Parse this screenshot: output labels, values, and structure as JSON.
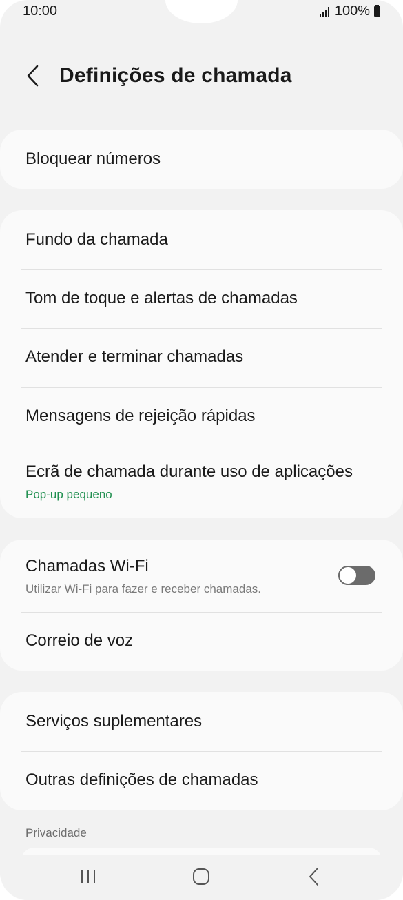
{
  "status_bar": {
    "time": "10:00",
    "battery": "100%",
    "icons": [
      "signal-icon",
      "battery-icon"
    ]
  },
  "header": {
    "title": "Definições de chamada",
    "back_icon": "chevron-left-icon"
  },
  "groups": [
    {
      "items": [
        {
          "title": "Bloquear números"
        }
      ]
    },
    {
      "items": [
        {
          "title": "Fundo da chamada"
        },
        {
          "title": "Tom de toque e alertas de chamadas"
        },
        {
          "title": "Atender e terminar chamadas"
        },
        {
          "title": "Mensagens de rejeição rápidas"
        },
        {
          "title": "Ecrã de chamada durante uso de aplicações",
          "subtitle": "Pop-up pequeno"
        }
      ]
    },
    {
      "items": [
        {
          "title": "Chamadas Wi-Fi",
          "subtitle": "Utilizar Wi-Fi para fazer e receber chamadas.",
          "toggle": false
        },
        {
          "title": "Correio de voz"
        }
      ]
    },
    {
      "items": [
        {
          "title": "Serviços suplementares"
        },
        {
          "title": "Outras definições de chamadas"
        }
      ]
    }
  ],
  "sections": {
    "privacy_label": "Privacidade"
  },
  "nav_bar": {
    "icons": [
      "recent-apps-icon",
      "home-icon",
      "back-icon"
    ]
  },
  "colors": {
    "background": "#f2f2f2",
    "card": "#fafafa",
    "accent_green": "#1f8f4f",
    "subtitle_gray": "#7a7a7a",
    "toggle_off": "#6b6b6b"
  }
}
